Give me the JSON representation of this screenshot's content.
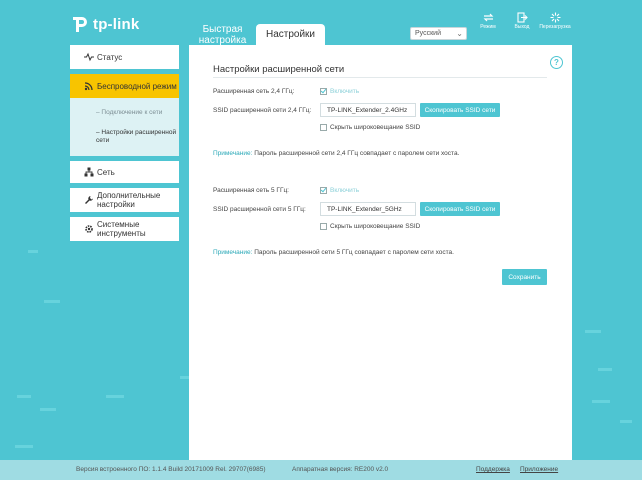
{
  "header": {
    "logo_text": "tp-link",
    "tabs": [
      {
        "label": "Быстрая настройка"
      },
      {
        "label": "Настройки"
      }
    ],
    "language": "Русский",
    "buttons": [
      {
        "label": "Режим",
        "icon": "mode-icon"
      },
      {
        "label": "Выход",
        "icon": "logout-icon"
      },
      {
        "label": "Перезагрузка",
        "icon": "reboot-icon"
      }
    ]
  },
  "sidebar": {
    "items": [
      {
        "label": "Статус",
        "icon": "pulse-icon"
      },
      {
        "label": "Беспроводной режим",
        "icon": "wifi-icon"
      },
      {
        "label": "Сеть",
        "icon": "network-icon"
      },
      {
        "label": "Дополнительные настройки",
        "icon": "wrench-icon"
      },
      {
        "label": "Системные инструменты",
        "icon": "gear-icon"
      }
    ],
    "submenu": [
      {
        "label": "Подключение к сети"
      },
      {
        "label": "Настройки расширенной сети"
      }
    ]
  },
  "main": {
    "title": "Настройки расширенной сети",
    "help_icon": "help-icon",
    "band24": {
      "label": "Расширенная сеть 2,4 ГГц:",
      "enable_label": "Включить",
      "enabled": true,
      "ssid_label": "SSID расширенной сети 2,4 ГГц:",
      "ssid_value": "TP-LINK_Extender_2.4GHz",
      "copy_button": "Скопировать SSID сети",
      "hide_label": "Скрыть широковещание SSID",
      "hide_checked": false,
      "note_key": "Примечание:",
      "note_text": "Пароль расширенной сети 2,4 ГГц совпадает с паролем сети хоста."
    },
    "band5": {
      "label": "Расширенная сеть 5 ГГц:",
      "enable_label": "Включить",
      "enabled": true,
      "ssid_label": "SSID расширенной сети 5 ГГц:",
      "ssid_value": "TP-LINK_Extender_5GHz",
      "copy_button": "Скопировать SSID сети",
      "hide_label": "Скрыть широковещание SSID",
      "hide_checked": false,
      "note_key": "Примечание:",
      "note_text": "Пароль расширенной сети 5 ГГц совпадает с паролем сети хоста."
    },
    "save_button": "Сохранить"
  },
  "footer": {
    "firmware": "Версия встроенного ПО: 1.1.4 Build 20171009 Rel. 29707(6985)",
    "hardware": "Аппаратная версия: RE200 v2.0",
    "support_link": "Поддержка",
    "app_link": "Приложение"
  },
  "colors": {
    "background": "#4ec5d2",
    "accent": "#4ec5d2",
    "active_menu": "#f8c400"
  }
}
